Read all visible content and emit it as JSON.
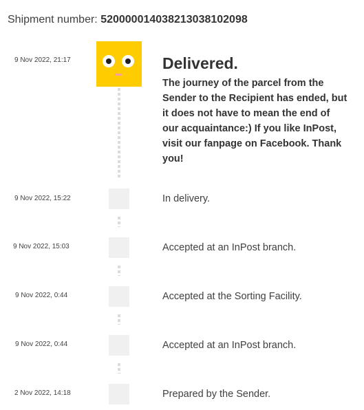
{
  "shipment": {
    "label": "Shipment number:",
    "number": "520000014038213038102098"
  },
  "delivered": {
    "date": "9 Nov 2022, 21:17",
    "title": "Delivered.",
    "description": "The journey of the parcel from the Sender to the Recipient has ended, but it does not have to mean the end of our acquaintance:) If you like InPost, visit our fanpage on Facebook. Thank you!",
    "avatar_icon": "smiling-face-icon",
    "avatar_color": "#ffcc00"
  },
  "events": [
    {
      "date": "9 Nov 2022, 15:22",
      "status": "In delivery."
    },
    {
      "date": "9 Nov 2022, 15:03",
      "status": "Accepted at an InPost branch."
    },
    {
      "date": "9 Nov 2022, 0:44",
      "status": "Accepted at the Sorting Facility."
    },
    {
      "date": "9 Nov 2022, 0:44",
      "status": "Accepted at an InPost branch."
    },
    {
      "date": "2 Nov 2022, 14:18",
      "status": "Prepared by the Sender."
    }
  ]
}
